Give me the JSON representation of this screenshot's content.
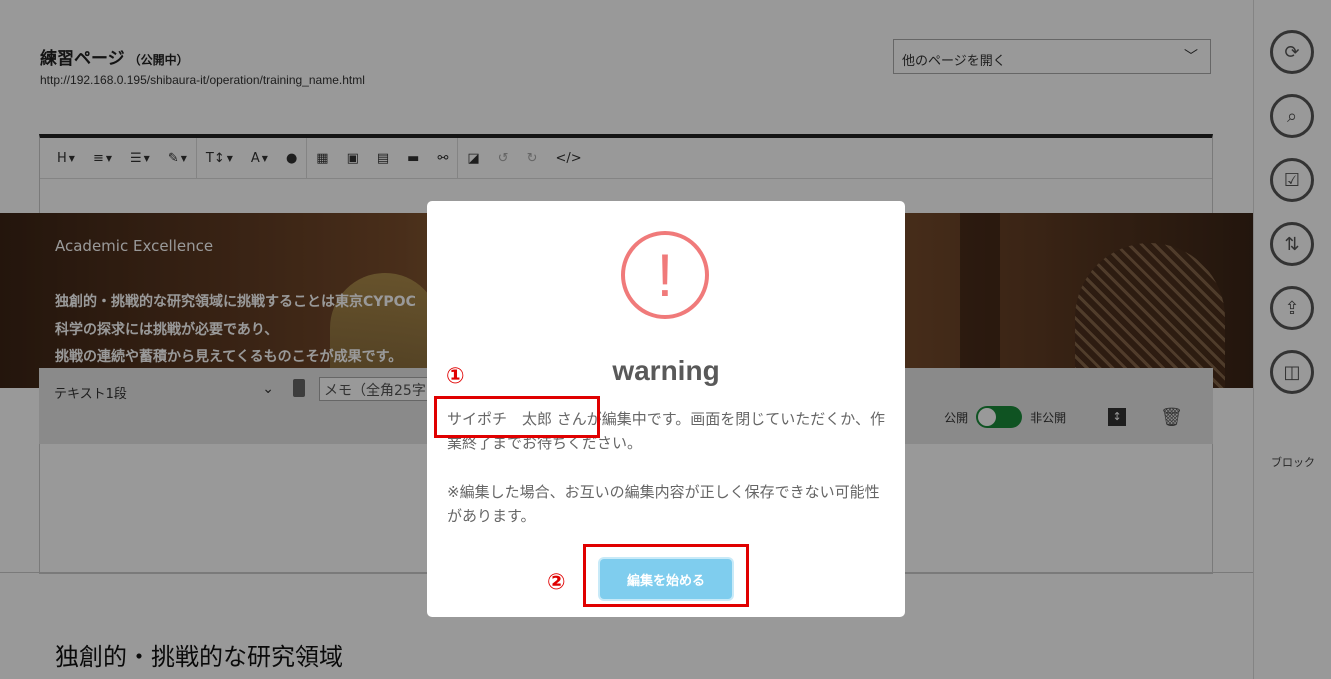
{
  "page": {
    "title": "練習ページ",
    "status": "（公開中）",
    "url": "http://192.168.0.195/shibaura-it/operation/training_name.html",
    "page_select": "他のページを開く"
  },
  "toolbar": {
    "heading": "H",
    "font_size": "T↕",
    "font_color": "A"
  },
  "hero": {
    "lead": "Academic Excellence",
    "lines": [
      "独創的・挑戦的な研究領域に挑戦することは東京CYPOC",
      "科学の探求には挑戦が必要であり、",
      "挑戦の連続や蓄積から見えてくるものこそが成果です。"
    ]
  },
  "block": {
    "type": "テキスト1段",
    "memo_placeholder": "メモ（全角25字",
    "public_label": "公開",
    "private_label": "非公開"
  },
  "section_heading": "独創的・挑戦的な研究領域",
  "sidebar": {
    "block_label": "ブロック"
  },
  "modal": {
    "icon": "!",
    "title": "warning",
    "user": "サイポチ　太郎",
    "message_rest": " さんが編集中です。画面を閉じていただくか、作業終了までお待ちください。",
    "note": "※編集した場合、お互いの編集内容が正しく保存できない可能性があります。",
    "start_button": "編集を始める"
  },
  "annotations": {
    "marker1": "①",
    "marker2": "②"
  },
  "colors": {
    "warning": "#f07a7a",
    "button": "#7fcdee",
    "highlight": "#e00000",
    "toggle_on": "#1a8a3a"
  }
}
